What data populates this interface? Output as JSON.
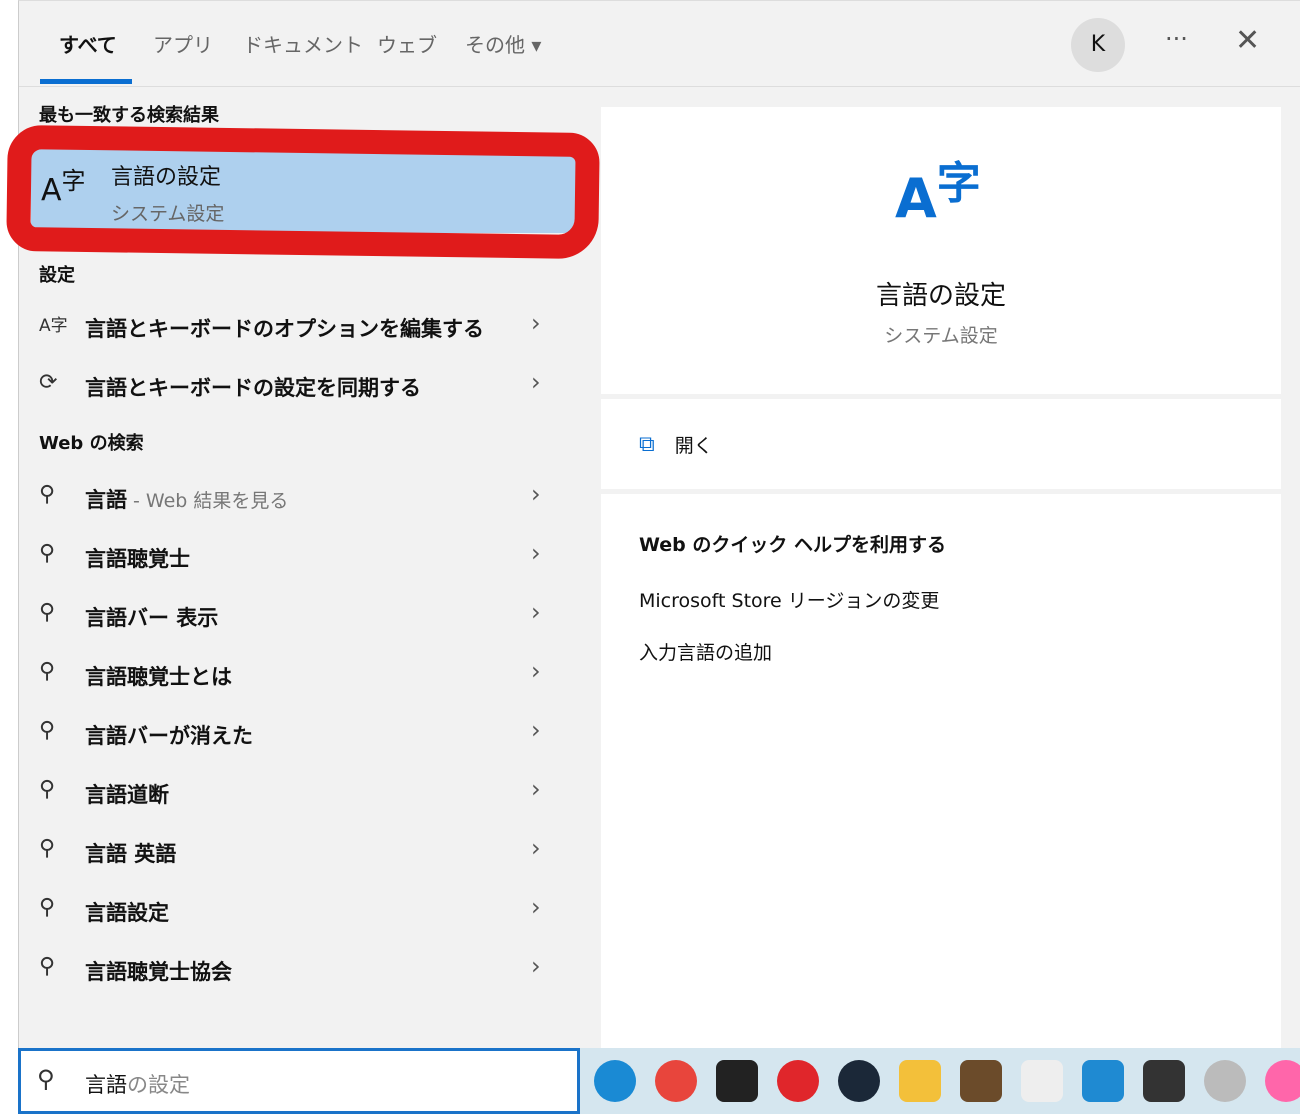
{
  "tabs": [
    "すべて",
    "アプリ",
    "ドキュメント",
    "ウェブ",
    "その他 ▾"
  ],
  "avatar": "K",
  "more": "···",
  "close": "✕",
  "best_header": "最も一致する検索結果",
  "best": {
    "title": "言語の設定",
    "subtitle": "システム設定",
    "icon": "A字"
  },
  "settings_header": "設定",
  "settings": [
    {
      "label": "言語とキーボードのオプションを編集する",
      "icon": "language-icon"
    },
    {
      "label": "言語とキーボードの設定を同期する",
      "icon": "sync-icon"
    }
  ],
  "web_header": "Web の検索",
  "web": [
    {
      "label": "言語",
      "sub": " - Web 結果を見る"
    },
    {
      "label": "言語聴覚士"
    },
    {
      "label": "言語バー 表示"
    },
    {
      "label": "言語聴覚士とは"
    },
    {
      "label": "言語バーが消えた"
    },
    {
      "label": "言語道断"
    },
    {
      "label": "言語 英語"
    },
    {
      "label": "言語設定"
    },
    {
      "label": "言語聴覚士協会"
    }
  ],
  "detail": {
    "title": "言語の設定",
    "subtitle": "システム設定",
    "open": "開く",
    "help_header": "Web のクイック ヘルプを利用する",
    "links": [
      "Microsoft Store リージョンの変更",
      "入力言語の追加"
    ]
  },
  "search": {
    "typed": "言語",
    "suggest": "の設定"
  },
  "taskbar": [
    "edge",
    "chrome",
    "epic-games",
    "riot",
    "steam",
    "file-explorer",
    "minecraft",
    "notion",
    "vscode",
    "terminal",
    "speaker",
    "osu"
  ]
}
